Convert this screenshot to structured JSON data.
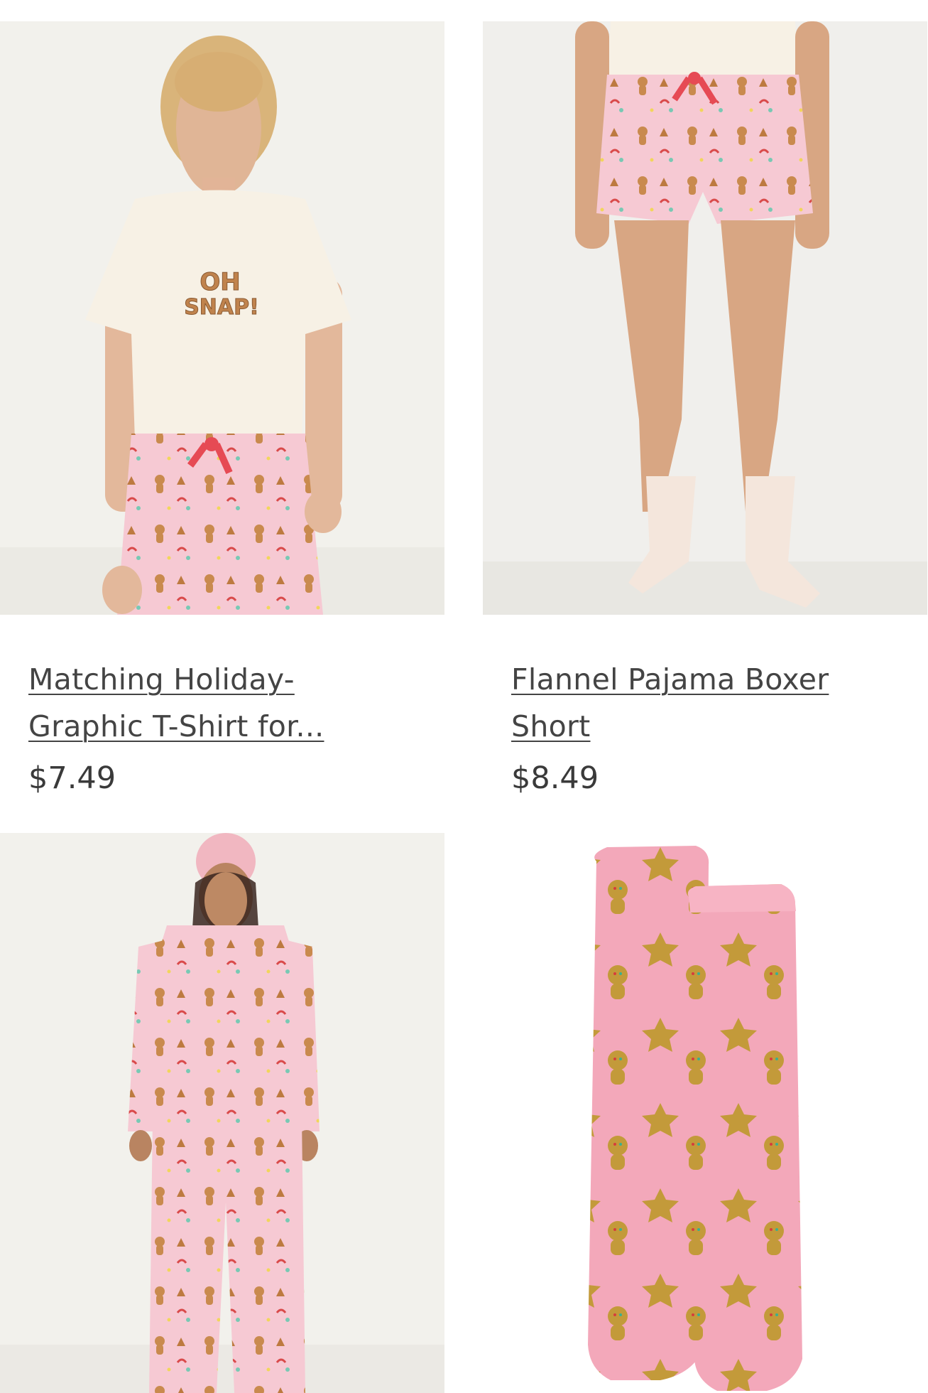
{
  "products": [
    {
      "title_line1": "Matching Holiday-",
      "title_line2": "Graphic T-Shirt for...",
      "price": "$7.49",
      "graphic_text_line1": "OH",
      "graphic_text_line2": "SNAP!"
    },
    {
      "title_line1": "Flannel Pajama Boxer",
      "title_line2": "Short",
      "price": "$8.49"
    },
    {},
    {}
  ],
  "colors": {
    "background": "#ffffff",
    "photo_bg": "#f3f2ef",
    "pajama_pink": "#f4c3cf",
    "gingerbread": "#c98a4e",
    "sock_pink": "#f3a9bb",
    "text": "#444444"
  }
}
